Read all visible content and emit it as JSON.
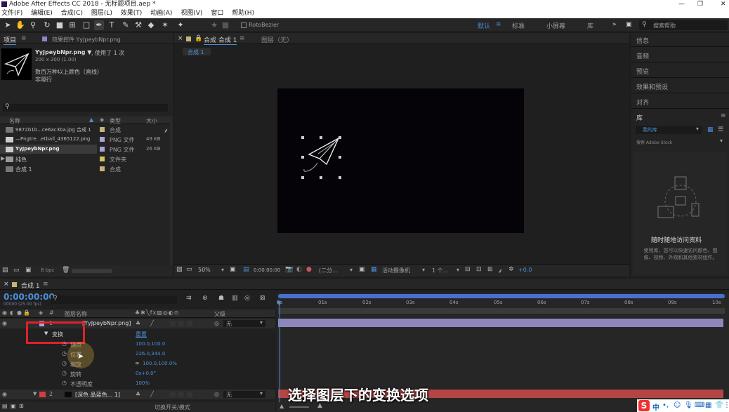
{
  "window": {
    "title": "Adobe After Effects CC 2018 - 无标题项目.aep *",
    "controls": [
      "—",
      "❐",
      "✕"
    ]
  },
  "menu": [
    "文件(F)",
    "编辑(E)",
    "合成(C)",
    "图层(L)",
    "效果(T)",
    "动画(A)",
    "视图(V)",
    "窗口",
    "帮助(H)"
  ],
  "toolbar": {
    "roto": "RotoBezier",
    "workspaces": [
      "默认",
      "标准",
      "小屏幕",
      "库"
    ],
    "search_placeholder": "搜索帮助",
    "more": "»"
  },
  "project": {
    "tab": "项目",
    "effects_tab": "效果控件 YyJpeybNpr.png",
    "file_name": "YyJpeybNpr.png ▼",
    "used": ", 使用了 1 次",
    "dims": "200 x 200 (1.00)",
    "desc": "数百万种以上颜色（直线）",
    "desc2": "非隔行",
    "headers": [
      "名称",
      "类型",
      "大小"
    ],
    "items": [
      {
        "name": "9872b1b...ce6ac3ba.jpg 合成 1",
        "type": "合成",
        "size": "",
        "color": "#c8b27a"
      },
      {
        "name": "—Pngtre...etball_4365122.png",
        "type": "PNG 文件",
        "size": "49 KB",
        "color": "#a9a3d6"
      },
      {
        "name": "YyJpeybNpr.png",
        "type": "PNG 文件",
        "size": "26 KB",
        "color": "#a9a3d6"
      },
      {
        "name": "纯色",
        "type": "文件夹",
        "size": "",
        "color": "#d6c35a"
      },
      {
        "name": "合成 1",
        "type": "合成",
        "size": "",
        "color": "#c8b27a"
      }
    ],
    "bpc": "8 bpc"
  },
  "comp": {
    "tab": "合成 合成 1",
    "layer_tab": "图层（无）",
    "crumb": "合成 1",
    "zoom": "50%",
    "time": "0:00:00:00",
    "res": "(二分...",
    "camera": "活动摄像机",
    "views": "1 个...",
    "offset": "+0.0"
  },
  "right": {
    "panels": [
      "信息",
      "音频",
      "预览",
      "效果和预设",
      "对齐"
    ],
    "library": "库",
    "lib_select": "我的库",
    "lib_search": "搜索 Adobe Stock",
    "lib_title": "随时随地访问资料",
    "lib_desc": "使用库，您可以快速访问颜色、图像、视频、外观和其他素材组件。"
  },
  "timeline": {
    "tab": "合成 1",
    "timecode": "0:00:00:00",
    "fps": "00000 (25.00 fps)",
    "col_layer": "图层名称",
    "col_parent": "父级",
    "layers": [
      {
        "num": "1",
        "name": "[YyJpeybNpr.png]",
        "parent": "无"
      },
      {
        "num": "2",
        "name": "[深色 品蓝色... 1]",
        "parent": "无"
      }
    ],
    "transform": "变换",
    "reset": "重置",
    "props": [
      {
        "name": "锚点",
        "value": "100.0,100.0"
      },
      {
        "name": "位置",
        "value": "226.0,344.0"
      },
      {
        "name": "缩放",
        "value": "100.0,100.0%"
      },
      {
        "name": "旋转",
        "value": "0x+0.0°"
      },
      {
        "name": "不透明度",
        "value": "100%"
      }
    ],
    "ruler": [
      "0s",
      "01s",
      "02s",
      "03s",
      "04s",
      "05s",
      "06s",
      "07s",
      "08s",
      "09s",
      "10s"
    ],
    "switch_mode": "切换开关/模式",
    "subtitle": "选择图层下的变换选项"
  }
}
